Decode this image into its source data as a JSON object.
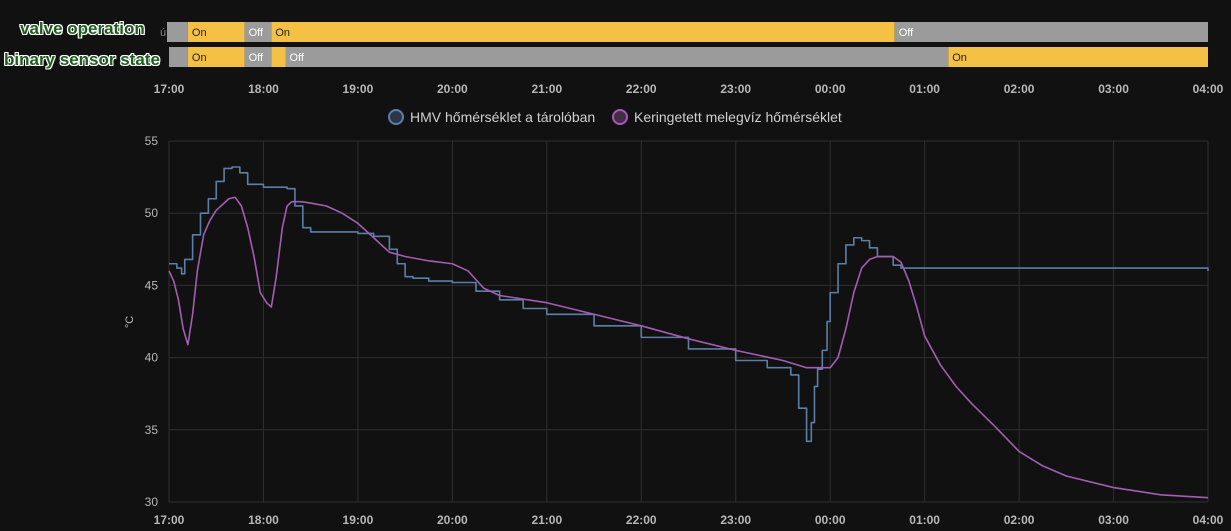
{
  "overlay": {
    "label_1": "valve operation",
    "label_2": "binary sensor state"
  },
  "timeline": {
    "row_1_prefix": "ú",
    "on_color": "#f4c144",
    "off_color": "#9b9b9b",
    "rows": [
      {
        "segments": [
          {
            "start": "16:58",
            "end": "17:12",
            "state": "off",
            "label": ""
          },
          {
            "start": "17:12",
            "end": "17:48",
            "state": "on",
            "label": "On"
          },
          {
            "start": "17:48",
            "end": "18:05",
            "state": "off",
            "label": "Off"
          },
          {
            "start": "18:05",
            "end": "00:41",
            "state": "on",
            "label": "On"
          },
          {
            "start": "00:41",
            "end": "04:00",
            "state": "off",
            "label": "Off"
          }
        ]
      },
      {
        "segments": [
          {
            "start": "17:00",
            "end": "17:12",
            "state": "off",
            "label": ""
          },
          {
            "start": "17:12",
            "end": "17:48",
            "state": "on",
            "label": "On"
          },
          {
            "start": "17:48",
            "end": "18:05",
            "state": "off",
            "label": "Off"
          },
          {
            "start": "18:05",
            "end": "18:14",
            "state": "on",
            "label": ""
          },
          {
            "start": "18:14",
            "end": "01:15",
            "state": "off",
            "label": "Off"
          },
          {
            "start": "01:15",
            "end": "04:00",
            "state": "on",
            "label": "On"
          }
        ]
      }
    ]
  },
  "chart_data": {
    "type": "line",
    "ylabel": "°C",
    "ylim": [
      30,
      55
    ],
    "yticks": [
      30,
      35,
      40,
      45,
      50,
      55
    ],
    "xticks": [
      "17:00",
      "18:00",
      "19:00",
      "20:00",
      "21:00",
      "22:00",
      "23:00",
      "00:00",
      "01:00",
      "02:00",
      "03:00",
      "04:00"
    ],
    "grid": true,
    "legend_position": "top-center",
    "series": [
      {
        "name": "HMV hőmérséklet a tárolóban",
        "color": "#5b7fa8",
        "step": true,
        "x": [
          "17:00",
          "17:05",
          "17:08",
          "17:10",
          "17:15",
          "17:20",
          "17:25",
          "17:30",
          "17:35",
          "17:40",
          "17:45",
          "17:50",
          "18:00",
          "18:10",
          "18:15",
          "18:20",
          "18:25",
          "18:30",
          "18:40",
          "18:50",
          "19:00",
          "19:10",
          "19:20",
          "19:25",
          "19:30",
          "19:35",
          "19:45",
          "20:00",
          "20:15",
          "20:30",
          "20:45",
          "21:00",
          "21:30",
          "22:00",
          "22:30",
          "23:00",
          "23:20",
          "23:35",
          "23:40",
          "23:45",
          "23:48",
          "23:50",
          "23:52",
          "23:55",
          "23:58",
          "24:00",
          "24:05",
          "24:10",
          "24:15",
          "24:20",
          "24:25",
          "24:30",
          "24:40",
          "24:45",
          "24:50",
          "24:55",
          "25:00",
          "26:00",
          "27:00",
          "28:00"
        ],
        "y": [
          46.5,
          46.2,
          45.8,
          46.8,
          48.5,
          50.0,
          51.0,
          52.2,
          53.1,
          53.2,
          52.8,
          52.0,
          51.8,
          51.8,
          51.7,
          50.5,
          49.0,
          48.7,
          48.7,
          48.7,
          48.6,
          48.4,
          47.5,
          46.5,
          45.6,
          45.5,
          45.3,
          45.2,
          44.6,
          44.0,
          43.4,
          43.0,
          42.2,
          41.4,
          40.6,
          39.8,
          39.3,
          38.8,
          36.5,
          34.2,
          35.5,
          38.0,
          39.2,
          40.5,
          42.5,
          44.5,
          46.5,
          47.8,
          48.3,
          48.1,
          47.6,
          47.0,
          46.4,
          46.2,
          46.2,
          46.2,
          46.2,
          46.2,
          46.2,
          46.0
        ]
      },
      {
        "name": "Keringetett melegvíz hőmérséklet",
        "color": "#a35db3",
        "step": false,
        "x": [
          "17:00",
          "17:03",
          "17:06",
          "17:09",
          "17:12",
          "17:15",
          "17:18",
          "17:22",
          "17:26",
          "17:30",
          "17:34",
          "17:38",
          "17:42",
          "17:46",
          "17:50",
          "17:54",
          "17:58",
          "18:02",
          "18:05",
          "18:08",
          "18:12",
          "18:15",
          "18:18",
          "18:24",
          "18:30",
          "18:40",
          "18:50",
          "19:00",
          "19:10",
          "19:20",
          "19:30",
          "19:45",
          "20:00",
          "20:10",
          "20:15",
          "20:20",
          "20:30",
          "21:00",
          "21:30",
          "22:00",
          "22:30",
          "23:00",
          "23:30",
          "23:45",
          "24:00",
          "24:05",
          "24:10",
          "24:15",
          "24:20",
          "24:25",
          "24:30",
          "24:40",
          "24:45",
          "24:50",
          "24:55",
          "25:00",
          "25:10",
          "25:20",
          "25:30",
          "25:45",
          "26:00",
          "26:15",
          "26:30",
          "27:00",
          "27:30",
          "28:00"
        ],
        "y": [
          46.0,
          45.3,
          44.0,
          42.0,
          40.9,
          43.0,
          46.0,
          48.5,
          49.5,
          50.2,
          50.6,
          51.0,
          51.1,
          50.5,
          49.0,
          47.0,
          44.5,
          43.8,
          43.5,
          45.5,
          49.0,
          50.5,
          50.8,
          50.8,
          50.7,
          50.5,
          50.0,
          49.3,
          48.3,
          47.3,
          47.0,
          46.7,
          46.5,
          46.0,
          45.4,
          44.8,
          44.3,
          43.8,
          43.0,
          42.2,
          41.3,
          40.5,
          39.8,
          39.3,
          39.3,
          40.0,
          42.0,
          44.5,
          46.2,
          46.8,
          47.0,
          47.0,
          46.6,
          45.3,
          43.5,
          41.5,
          39.5,
          38.0,
          36.8,
          35.2,
          33.5,
          32.5,
          31.8,
          31.0,
          30.5,
          30.3
        ]
      }
    ]
  }
}
